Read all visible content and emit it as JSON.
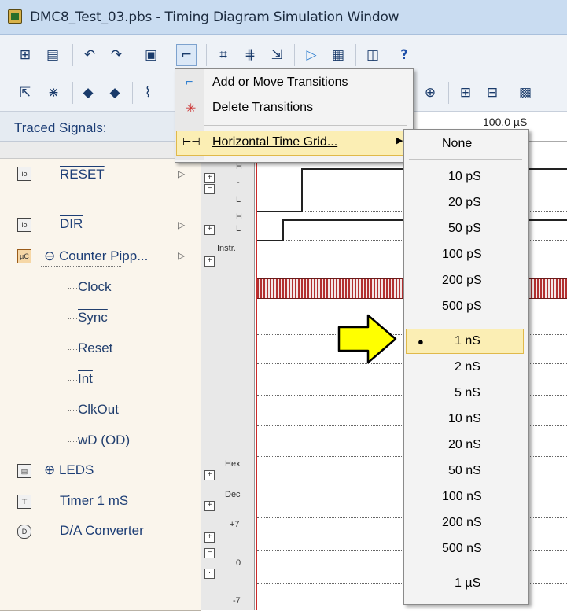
{
  "window": {
    "title": "DMC8_Test_03.pbs - Timing Diagram Simulation Window"
  },
  "panel": {
    "header": "Traced Signals:"
  },
  "ruler": {
    "time": "100,0 µS"
  },
  "signals": {
    "reset": "RESET",
    "dir": "DIR",
    "counter": "Counter Pipp...",
    "leds": "LEDS",
    "timer": "Timer 1 mS",
    "da": "D/A Converter"
  },
  "counter_children": [
    "Clock",
    "Sync",
    "Reset",
    "Int",
    "ClkOut",
    "wD (OD)"
  ],
  "scale": {
    "h": "H",
    "dash": "-",
    "l": "L",
    "h2": "H",
    "l2": "L",
    "instr": "Instr.",
    "hex": "Hex",
    "dec": "Dec",
    "p7": "+7",
    "zero": "0",
    "m7": "-7"
  },
  "menu": {
    "add": "Add or Move Transitions",
    "delete": "Delete Transitions",
    "grid": "Horizontal Time Grid..."
  },
  "submenu": {
    "none": "None",
    "ps": [
      "10 pS",
      "20 pS",
      "50 pS",
      "100 pS",
      "200 pS",
      "500 pS"
    ],
    "ns": [
      "1 nS",
      "2 nS",
      "5 nS",
      "10 nS",
      "20 nS",
      "50 nS",
      "100 nS",
      "200 nS",
      "500 nS"
    ],
    "us": "1 µS",
    "selected": "1 nS"
  },
  "colors": {
    "highlight": "#fbeeb4",
    "arrow": "#ffff00",
    "title_bar": "#c9dcf1",
    "trace_red": "#cc2a2a"
  }
}
